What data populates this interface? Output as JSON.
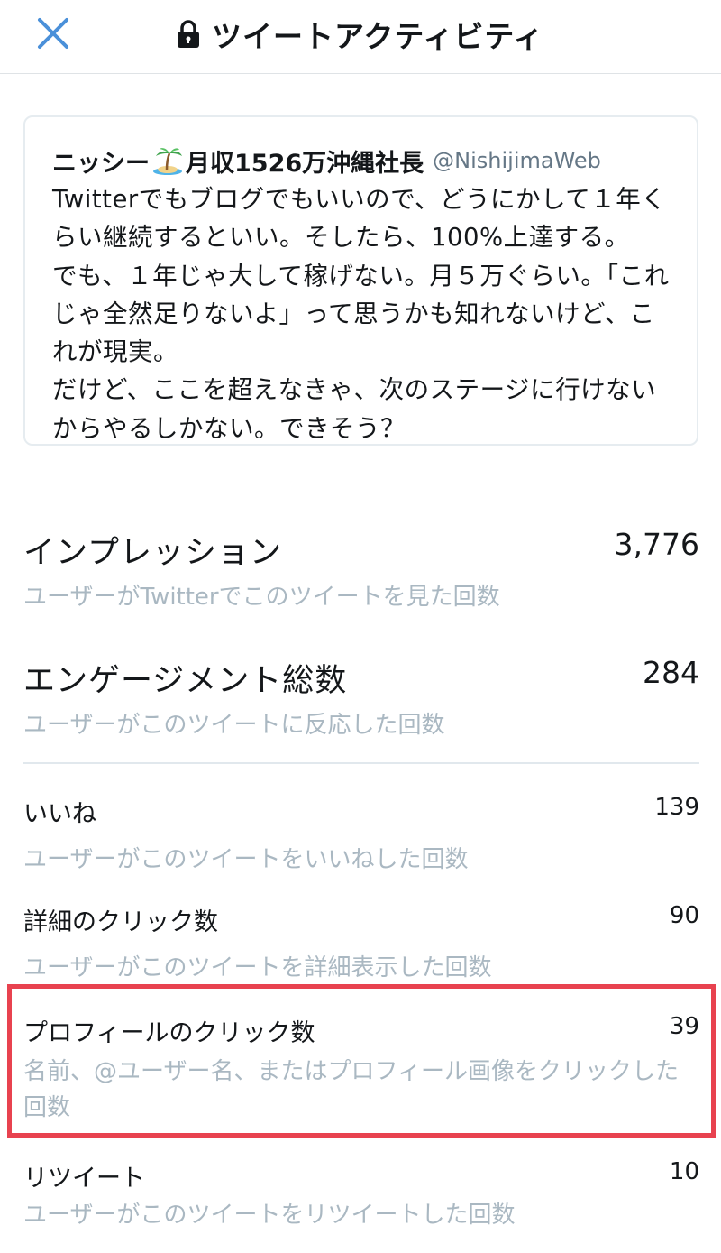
{
  "header": {
    "title": "ツイートアクティビティ",
    "close_icon": "close-icon",
    "lock_icon": "lock-icon"
  },
  "tweet": {
    "name_part1": "ニッシー",
    "name_icon": "desert-island-emoji",
    "name_part2": "月収1526万沖縄社長",
    "handle": "@NishijimaWeb",
    "body": "Twitterでもブログでもいいので、どうにかして１年くらい継続するといい。そしたら、100%上達する。\nでも、１年じゃ大して稼げない。月５万ぐらい。「これじゃ全然足りないよ」って思うかも知れないけど、これが現実。\nだけど、ここを超えなきゃ、次のステージに行けないからやるしかない。できそう？"
  },
  "stats": {
    "impressions": {
      "label": "インプレッション",
      "value": "3,776",
      "description": "ユーザーがTwitterでこのツイートを見た回数"
    },
    "engagements": {
      "label": "エンゲージメント総数",
      "value": "284",
      "description": "ユーザーがこのツイートに反応した回数"
    },
    "likes": {
      "label": "いいね",
      "value": "139",
      "description": "ユーザーがこのツイートをいいねした回数"
    },
    "detail_clicks": {
      "label": "詳細のクリック数",
      "value": "90",
      "description": "ユーザーがこのツイートを詳細表示した回数"
    },
    "profile_clicks": {
      "label": "プロフィールのクリック数",
      "value": "39",
      "description": "名前、@ユーザー名、またはプロフィール画像をクリックした回数"
    },
    "retweets": {
      "label": "リツイート",
      "value": "10",
      "description": "ユーザーがこのツイートをリツイートした回数"
    }
  },
  "colors": {
    "close_icon": "#4a90d9",
    "description_text": "#aab8c2",
    "highlight_border": "#e8424f"
  }
}
